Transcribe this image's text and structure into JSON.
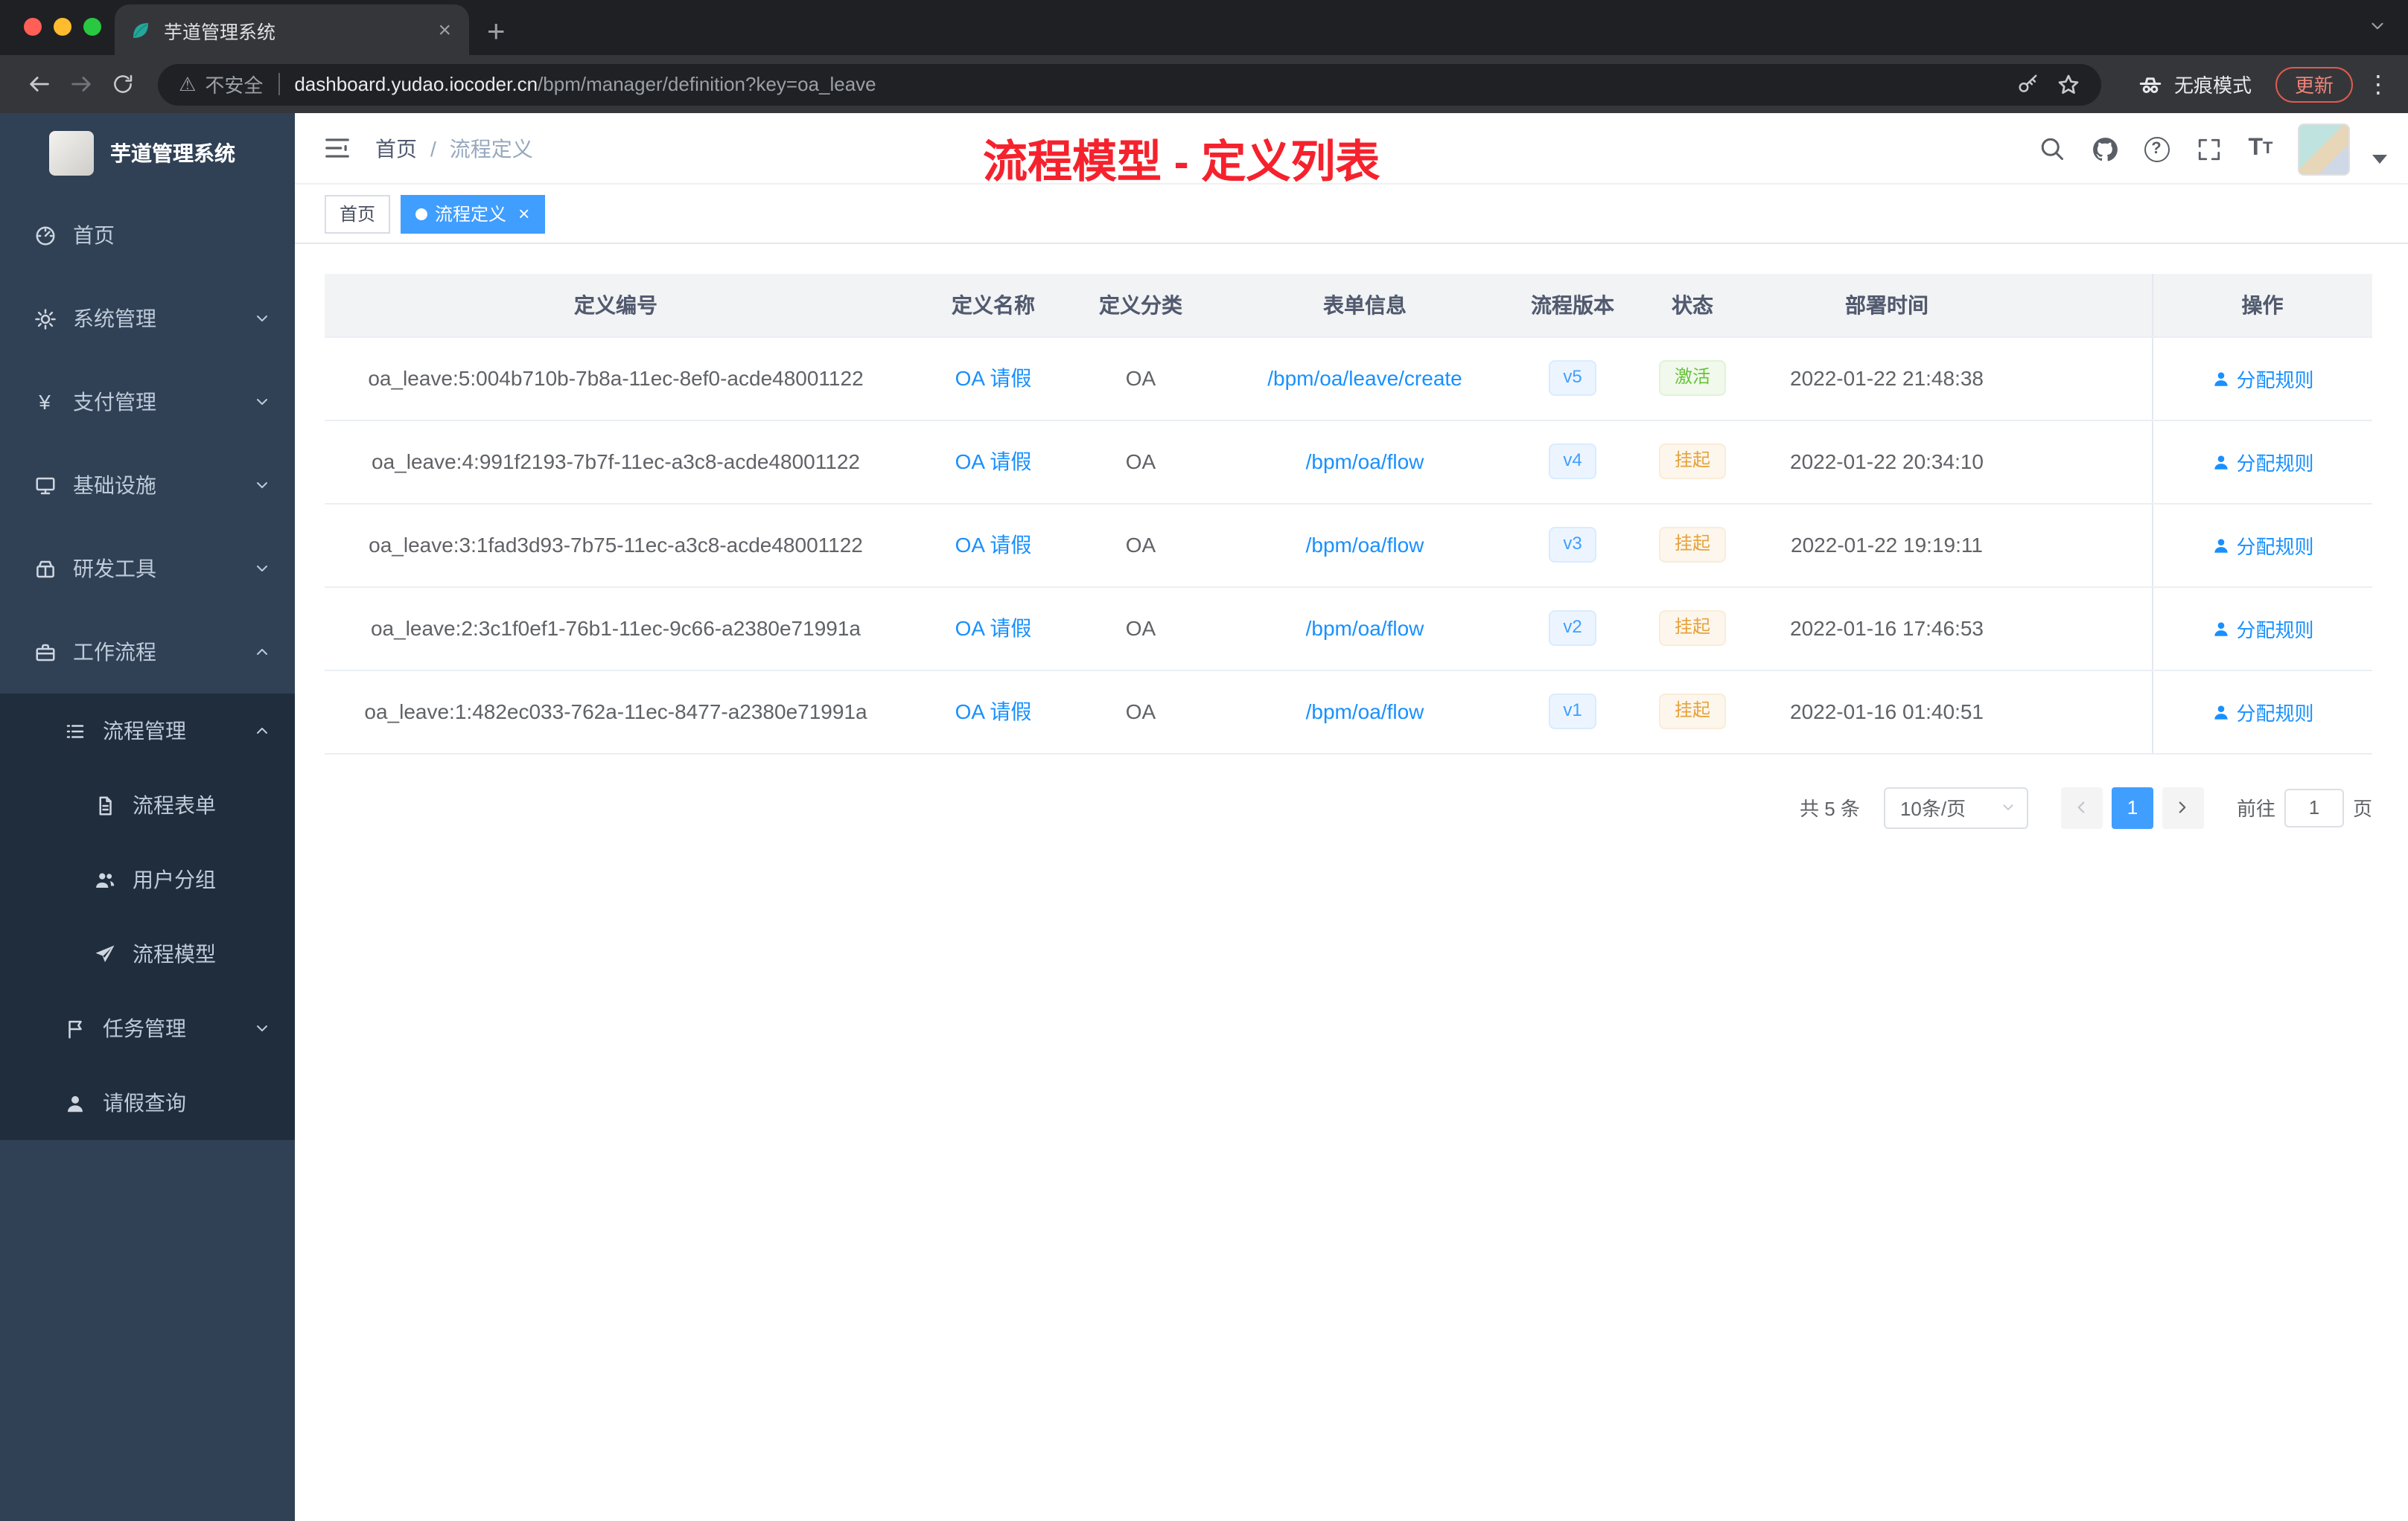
{
  "browser": {
    "tab_title": "芋道管理系统",
    "security_label": "不安全",
    "url_host": "dashboard.yudao.iocoder.cn",
    "url_path": "/bpm/manager/definition?key=oa_leave",
    "incognito_label": "无痕模式",
    "update_label": "更新"
  },
  "sidebar": {
    "logo_title": "芋道管理系统",
    "items": [
      {
        "label": "首页"
      },
      {
        "label": "系统管理"
      },
      {
        "label": "支付管理"
      },
      {
        "label": "基础设施"
      },
      {
        "label": "研发工具"
      },
      {
        "label": "工作流程"
      },
      {
        "label": "流程管理"
      },
      {
        "label": "流程表单"
      },
      {
        "label": "用户分组"
      },
      {
        "label": "流程模型"
      },
      {
        "label": "任务管理"
      },
      {
        "label": "请假查询"
      }
    ]
  },
  "header": {
    "breadcrumb_home": "首页",
    "breadcrumb_separator": "/",
    "breadcrumb_current": "流程定义",
    "overlay_title": "流程模型 - 定义列表"
  },
  "tags": {
    "home": "首页",
    "active": "流程定义"
  },
  "table": {
    "columns": [
      "定义编号",
      "定义名称",
      "定义分类",
      "表单信息",
      "流程版本",
      "状态",
      "部署时间",
      "操作"
    ],
    "action_label": "分配规则",
    "rows": [
      {
        "id": "oa_leave:5:004b710b-7b8a-11ec-8ef0-acde48001122",
        "name": "OA 请假",
        "category": "OA",
        "form": "/bpm/oa/leave/create",
        "version": "v5",
        "status": "激活",
        "time": "2022-01-22 21:48:38"
      },
      {
        "id": "oa_leave:4:991f2193-7b7f-11ec-a3c8-acde48001122",
        "name": "OA 请假",
        "category": "OA",
        "form": "/bpm/oa/flow",
        "version": "v4",
        "status": "挂起",
        "time": "2022-01-22 20:34:10"
      },
      {
        "id": "oa_leave:3:1fad3d93-7b75-11ec-a3c8-acde48001122",
        "name": "OA 请假",
        "category": "OA",
        "form": "/bpm/oa/flow",
        "version": "v3",
        "status": "挂起",
        "time": "2022-01-22 19:19:11"
      },
      {
        "id": "oa_leave:2:3c1f0ef1-76b1-11ec-9c66-a2380e71991a",
        "name": "OA 请假",
        "category": "OA",
        "form": "/bpm/oa/flow",
        "version": "v2",
        "status": "挂起",
        "time": "2022-01-16 17:46:53"
      },
      {
        "id": "oa_leave:1:482ec033-762a-11ec-8477-a2380e71991a",
        "name": "OA 请假",
        "category": "OA",
        "form": "/bpm/oa/flow",
        "version": "v1",
        "status": "挂起",
        "time": "2022-01-16 01:40:51"
      }
    ]
  },
  "pagination": {
    "total": "共 5 条",
    "page_size": "10条/页",
    "current_page": "1",
    "goto_label": "前往",
    "goto_value": "1",
    "page_label": "页"
  },
  "colors": {
    "accent_blue": "#409eff",
    "link_blue": "#1890ff",
    "status_active_green": "#67c23a",
    "status_suspended_orange": "#e6a23c",
    "overlay_red": "#f5222d",
    "sidebar_bg": "#304156",
    "submenu_bg": "#1f2d3d"
  }
}
